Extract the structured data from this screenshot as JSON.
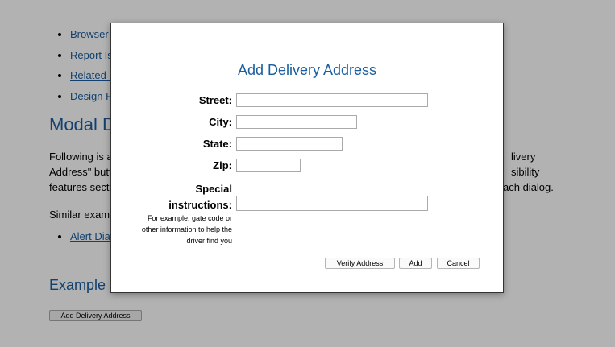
{
  "background": {
    "links": [
      "Browser",
      "Report Is",
      "Related I",
      "Design P"
    ],
    "modal_heading": "Modal D",
    "paragraph_lines": [
      {
        "left": "Following is a",
        "right": "livery"
      },
      {
        "left": "Address\" butt",
        "right": "sibility"
      },
      {
        "left": "features secti",
        "right": "ach dialog."
      }
    ],
    "similar_text": "Similar examp",
    "alert_link": "Alert Dial",
    "example_heading": "Example",
    "launch_button": "Add Delivery Address"
  },
  "dialog": {
    "title": "Add Delivery Address",
    "fields": {
      "street": {
        "label": "Street:",
        "value": ""
      },
      "city": {
        "label": "City:",
        "value": ""
      },
      "state": {
        "label": "State:",
        "value": ""
      },
      "zip": {
        "label": "Zip:",
        "value": ""
      }
    },
    "special": {
      "label_line1": "Special",
      "label_line2": "instructions:",
      "value": "",
      "help_line1": "For example, gate code or",
      "help_line2": "other information to help the",
      "help_line3": "driver find you"
    },
    "buttons": {
      "verify": "Verify Address",
      "add": "Add",
      "cancel": "Cancel"
    }
  },
  "colors": {
    "heading": "#1a5ea0",
    "overlay": "rgba(0,0,0,0.30)"
  }
}
